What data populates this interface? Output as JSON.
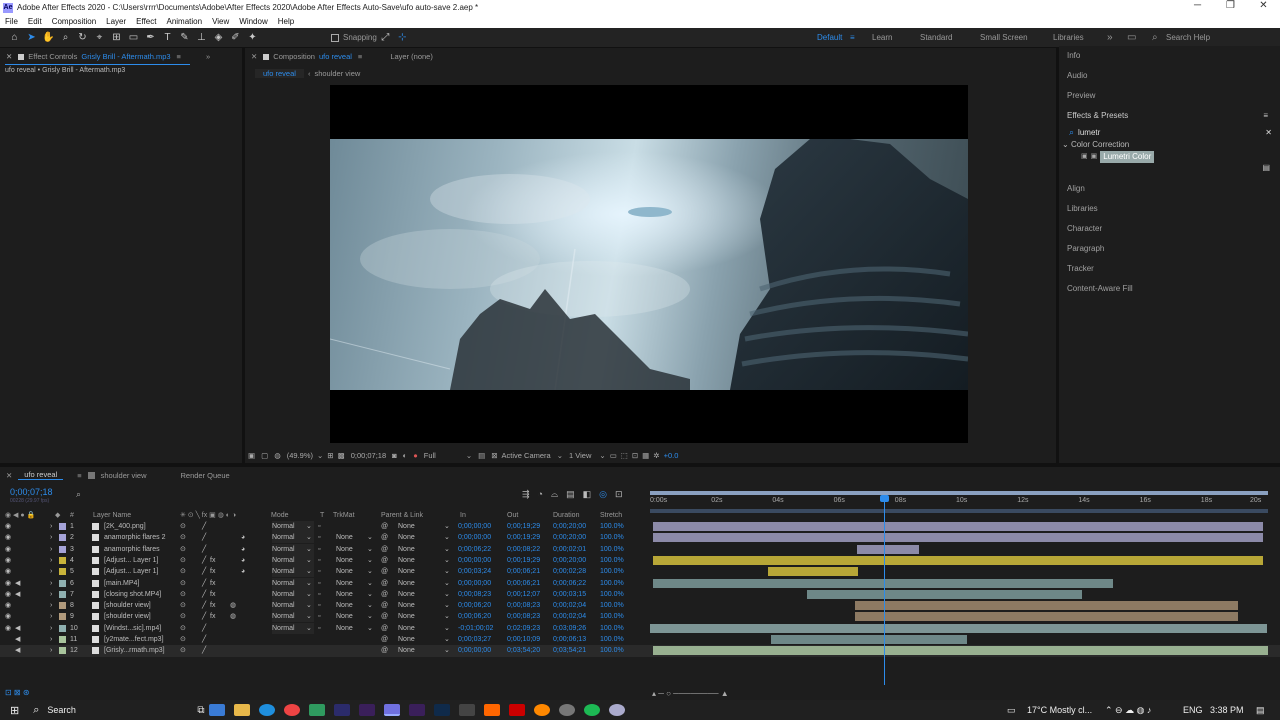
{
  "window": {
    "title": "Adobe After Effects 2020 - C:\\Users\\rrrr\\Documents\\Adobe\\After Effects 2020\\Adobe After Effects Auto-Save\\ufo auto-save 2.aep *",
    "icon": "Ae"
  },
  "menu": [
    "File",
    "Edit",
    "Composition",
    "Layer",
    "Effect",
    "Animation",
    "View",
    "Window",
    "Help"
  ],
  "toolbar": {
    "snapping": "Snapping",
    "workspaces": [
      "Default",
      "Learn",
      "Standard",
      "Small Screen",
      "Libraries"
    ],
    "search_help": "Search Help"
  },
  "effect_controls": {
    "tab": "Effect Controls",
    "tab_item": "Grisly Brill - Aftermath.mp3",
    "subtitle": "ufo reveal • Grisly Brill - Aftermath.mp3"
  },
  "composition": {
    "tab": "Composition",
    "tab_item": "ufo reveal",
    "layer_tab": "Layer  (none)",
    "crumbs": [
      "ufo reveal",
      "shoulder view"
    ],
    "zoom": "(49.9%)",
    "timecode": "0;00;07;18",
    "resolution": "Full",
    "camera": "Active Camera",
    "view": "1 View",
    "exposure": "+0.0"
  },
  "right_panel": {
    "top_items": [
      "Info",
      "Audio",
      "Preview"
    ],
    "effects_title": "Effects & Presets",
    "search_value": "lumetr",
    "category": "Color Correction",
    "effect": "Lumetri Color",
    "bottom_items": [
      "Align",
      "Libraries",
      "Character",
      "Paragraph",
      "Tracker",
      "Content-Aware Fill"
    ]
  },
  "timeline": {
    "tabs": [
      "ufo reveal",
      "shoulder view",
      "Render Queue"
    ],
    "current_time": "0;00;07;18",
    "fps": "00228 (29.97 fps)",
    "headers": {
      "layer_name": "Layer Name",
      "mode": "Mode",
      "t": "T",
      "trkmat": "TrkMat",
      "parent": "Parent & Link",
      "in": "In",
      "out": "Out",
      "duration": "Duration",
      "stretch": "Stretch"
    },
    "ruler": [
      "0:00s",
      "02s",
      "04s",
      "06s",
      "08s",
      "10s",
      "12s",
      "14s",
      "16s",
      "18s",
      "20s"
    ],
    "layers": [
      {
        "num": "1",
        "name": "[2K_400.png]",
        "mode": "Normal",
        "trk": "",
        "parent": "None",
        "in": "0;00;00;00",
        "out": "0;00;19;29",
        "dur": "0;00;20;00",
        "str": "100.0%",
        "color": "#a5a3d8"
      },
      {
        "num": "2",
        "name": "anamorphic flares 2",
        "mode": "Normal",
        "trk": "None",
        "parent": "None",
        "in": "0;00;00;00",
        "out": "0;00;19;29",
        "dur": "0;00;20;00",
        "str": "100.0%",
        "color": "#a5a3d8"
      },
      {
        "num": "3",
        "name": "anamorphic flares",
        "mode": "Normal",
        "trk": "None",
        "parent": "None",
        "in": "0;00;06;22",
        "out": "0;00;08;22",
        "dur": "0;00;02;01",
        "str": "100.0%",
        "color": "#a5a3d8"
      },
      {
        "num": "4",
        "name": "[Adjust... Layer 1]",
        "mode": "Normal",
        "trk": "None",
        "parent": "None",
        "in": "0;00;00;00",
        "out": "0;00;19;29",
        "dur": "0;00;20;00",
        "str": "100.0%",
        "color": "#c9b43a"
      },
      {
        "num": "5",
        "name": "[Adjust... Layer 1]",
        "mode": "Normal",
        "trk": "None",
        "parent": "None",
        "in": "0;00;03;24",
        "out": "0;00;06;21",
        "dur": "0;00;02;28",
        "str": "100.0%",
        "color": "#c9b43a"
      },
      {
        "num": "6",
        "name": "[main.MP4]",
        "mode": "Normal",
        "trk": "None",
        "parent": "None",
        "in": "0;00;00;00",
        "out": "0;00;06;21",
        "dur": "0;00;06;22",
        "str": "100.0%",
        "color": "#8fb0b0"
      },
      {
        "num": "7",
        "name": "[closing shot.MP4]",
        "mode": "Normal",
        "trk": "None",
        "parent": "None",
        "in": "0;00;08;23",
        "out": "0;00;12;07",
        "dur": "0;00;03;15",
        "str": "100.0%",
        "color": "#8fb0b0"
      },
      {
        "num": "8",
        "name": "[shoulder view]",
        "mode": "Normal",
        "trk": "None",
        "parent": "None",
        "in": "0;00;06;20",
        "out": "0;00;08;23",
        "dur": "0;00;02;04",
        "str": "100.0%",
        "color": "#b29b7d"
      },
      {
        "num": "9",
        "name": "[shoulder view]",
        "mode": "Normal",
        "trk": "None",
        "parent": "None",
        "in": "0;00;06;20",
        "out": "0;00;08;23",
        "dur": "0;00;02;04",
        "str": "100.0%",
        "color": "#b29b7d"
      },
      {
        "num": "10",
        "name": "[Windst...sic].mp4]",
        "mode": "Normal",
        "trk": "None",
        "parent": "None",
        "in": "-0;01;00;02",
        "out": "0;02;09;23",
        "dur": "0;03;09;26",
        "str": "100.0%",
        "color": "#8fb0b0"
      },
      {
        "num": "11",
        "name": "[y2mate...fect.mp3]",
        "mode": "",
        "trk": "",
        "parent": "None",
        "in": "0;00;03;27",
        "out": "0;00;10;09",
        "dur": "0;00;06;13",
        "str": "100.0%",
        "color": "#a8c49c"
      },
      {
        "num": "12",
        "name": "[Grisly...rmath.mp3]",
        "mode": "",
        "trk": "",
        "parent": "None",
        "in": "0;00;00;00",
        "out": "0;03;54;20",
        "dur": "0;03;54;21",
        "str": "100.0%",
        "color": "#a8c49c"
      }
    ]
  },
  "taskbar": {
    "search": "Search",
    "weather": "17°C  Mostly cl...",
    "lang": "ENG",
    "time": "3:38 PM"
  }
}
